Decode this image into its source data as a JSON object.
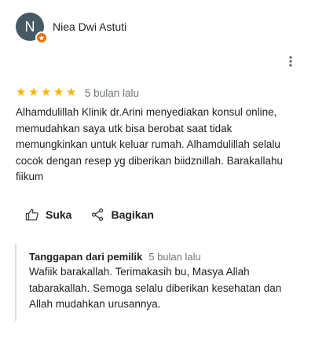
{
  "reviewer": {
    "avatar_initial": "N",
    "name": "Niea Dwi Astuti",
    "avatar_color": "#455a64",
    "badge_color": "#e8710a"
  },
  "menu": {
    "icon": "more-vert-icon"
  },
  "review": {
    "rating": 5,
    "rating_max": 5,
    "star_color": "#f9b400",
    "date": "5 bulan lalu",
    "text": "Alhamdulillah Klinik dr.Arini menyediakan konsul online, memudahkan saya utk bisa berobat saat tidak memungkinkan untuk keluar rumah. Alhamdulillah selalu cocok dengan resep yg diberikan biidznillah. Barakallahu fiikum"
  },
  "actions": {
    "like_label": "Suka",
    "like_icon": "thumbs-up-icon",
    "share_label": "Bagikan",
    "share_icon": "share-icon"
  },
  "owner_response": {
    "title": "Tanggapan dari pemilik",
    "date": "5 bulan lalu",
    "text": "Wafiik barakallah. Terimakasih bu, Masya Allah tabarakallah. Semoga selalu diberikan kesehatan dan Allah mudahkan urusannya."
  }
}
